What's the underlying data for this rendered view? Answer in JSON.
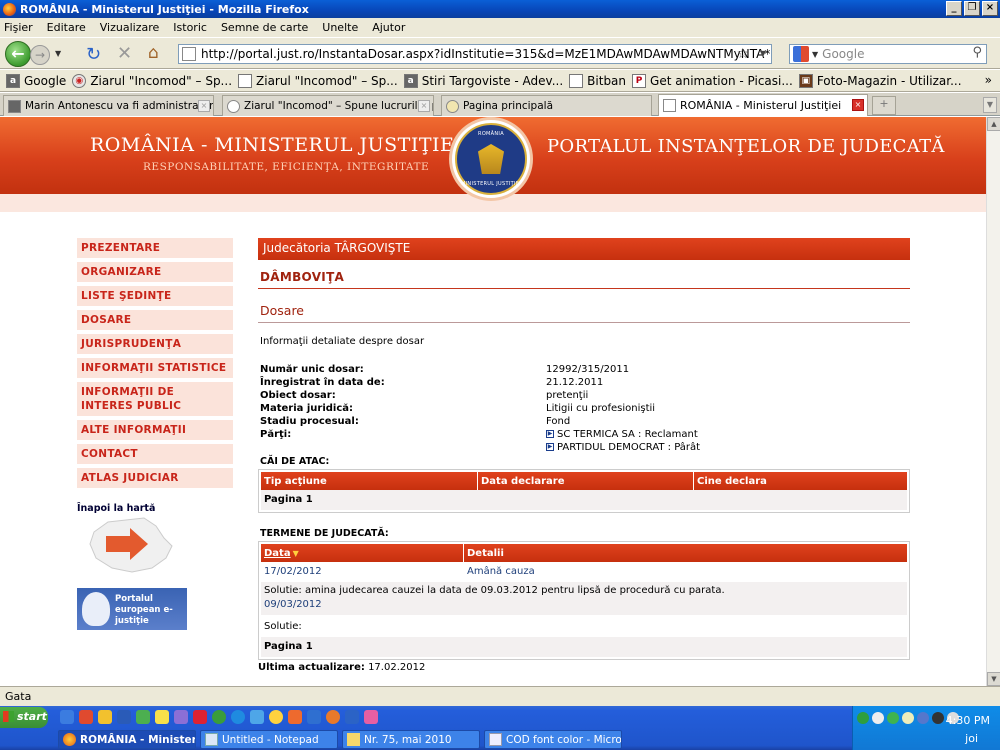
{
  "window": {
    "title": "ROMÂNIA - Ministerul Justiţiei - Mozilla Firefox"
  },
  "menu": [
    "Fişier",
    "Editare",
    "Vizualizare",
    "Istoric",
    "Semne de carte",
    "Unelte",
    "Ajutor"
  ],
  "nav": {
    "url": "http://portal.just.ro/InstantaDosar.aspx?idInstitutie=315&d=MzE1MDAwMDAwMDAwNTMyNTA*",
    "search_placeholder": "Google"
  },
  "bookmarks": [
    {
      "label": "Google"
    },
    {
      "label": "Ziarul \"Incomod\" – Sp..."
    },
    {
      "label": "Ziarul \"Incomod\" – Sp..."
    },
    {
      "label": "Stiri Targoviste - Adev..."
    },
    {
      "label": "Bitban"
    },
    {
      "label": "Get animation - Picasi..."
    },
    {
      "label": "Foto-Magazin - Utilizar..."
    }
  ],
  "tabs": [
    {
      "label": "Marin Antonescu va fi administratorul p..."
    },
    {
      "label": "Ziarul \"Incomod\" – Spune lucrurilor pe n..."
    },
    {
      "label": "Pagina principală"
    },
    {
      "label": "ROMÂNIA - Ministerul Justiţiei"
    }
  ],
  "banner": {
    "left_title": "ROMÂNIA - MINISTERUL JUSTIŢIEI",
    "left_subtitle": "RESPONSABILITATE, EFICIENŢA, INTEGRITATE",
    "right_title": "PORTALUL INSTANŢELOR DE JUDECATĂ",
    "seal_top": "ROMÂNIA",
    "seal_bottom": "MINISTERUL JUSTIŢIEI"
  },
  "sidebar": {
    "items": [
      "PREZENTARE",
      "ORGANIZARE",
      "LISTE ŞEDINŢE",
      "DOSARE",
      "JURISPRUDENŢA",
      "INFORMAŢII STATISTICE",
      "INFORMAŢII DE INTERES PUBLIC",
      "ALTE INFORMAŢII",
      "CONTACT",
      "ATLAS JUDICIAR"
    ],
    "back_to_map": "Înapoi la hartă",
    "euro_portal": "Portalul european e-justiţie"
  },
  "court": {
    "name": "Judecătoria TÂRGOVIŞTE",
    "county": "DÂMBOVIŢA",
    "section": "Dosare",
    "description": "Informaţii detaliate despre dosar"
  },
  "file": {
    "fields": [
      {
        "key": "Număr unic dosar:",
        "value": "12992/315/2011"
      },
      {
        "key": "Înregistrat în data de:",
        "value": "21.12.2011"
      },
      {
        "key": "Obiect dosar:",
        "value": "pretenţii"
      },
      {
        "key": "Materia juridică:",
        "value": "Litigii cu profesioniştii"
      },
      {
        "key": "Stadiu procesual:",
        "value": "Fond"
      },
      {
        "key": "Părţi:",
        "value": "SC TERMICA SA : Reclamant"
      }
    ],
    "party2": "PARTIDUL DEMOCRAT : Pârât"
  },
  "appeals": {
    "title": "CĂI DE ATAC:",
    "headers": [
      "Tip acţiune",
      "Data declarare",
      "Cine declara"
    ],
    "page": "Pagina 1"
  },
  "hearings": {
    "title": "TERMENE DE JUDECATĂ:",
    "headers": [
      "Data",
      "Detalii"
    ],
    "rows": [
      {
        "date": "17/02/2012",
        "detail": "Amână cauza",
        "solution": "Solutie: amina judecarea cauzei la data de 09.03.2012 pentru lipsă de procedură cu parata."
      },
      {
        "date": "09/03/2012",
        "detail": "",
        "solution": "Solutie:"
      }
    ],
    "page": "Pagina 1"
  },
  "last_update": {
    "label": "Ultima actualizare:",
    "value": "17.02.2012"
  },
  "status": "Gata",
  "taskbar": {
    "start": "start",
    "tasks": [
      "ROMÂNIA - Ministerul...",
      "Untitled - Notepad",
      "Nr. 75, mai 2010",
      "COD font color - Microso..."
    ],
    "clock": "4:30 PM",
    "day": "joi"
  },
  "colors": {
    "accent": "#c8251a",
    "banner": "#d8401b",
    "xp_blue": "#245edb"
  }
}
